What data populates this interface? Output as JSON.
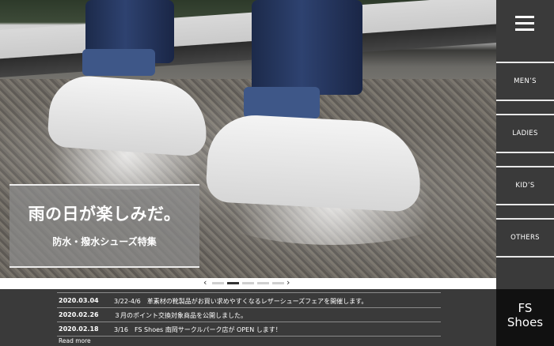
{
  "hero": {
    "headline": "雨の日が楽しみだ。",
    "subheadline": "防水・撥水シューズ特集",
    "slider": {
      "prev_glyph": "‹",
      "next_glyph": "›",
      "slide_count": 5,
      "active_slide": 2
    }
  },
  "news": {
    "items": [
      {
        "date": "2020.03.04",
        "text": "3/22-4/6　革素材の靴製品がお買い求めやすくなるレザーシューズフェアを開催します。"
      },
      {
        "date": "2020.02.26",
        "text": "３月のポイント交換対象商品を公開しました。"
      },
      {
        "date": "2020.02.18",
        "text": "3/16　FS Shoes 南岡サークルパーク店が OPEN します！"
      }
    ],
    "read_more": "Read more"
  },
  "sidebar": {
    "menu_icon": "hamburger-icon",
    "items": [
      {
        "label": "MEN’S"
      },
      {
        "label": "LADIES"
      },
      {
        "label": "KID’S"
      },
      {
        "label": "OTHERS"
      }
    ],
    "logo": {
      "line1": "FS",
      "line2": "Shoes"
    }
  },
  "colors": {
    "background": "#3a3a3a",
    "logo_background": "#111111",
    "caption_overlay": "#8c8c8c",
    "active_dot": "#333333",
    "inactive_dot": "#cfcfcf"
  }
}
